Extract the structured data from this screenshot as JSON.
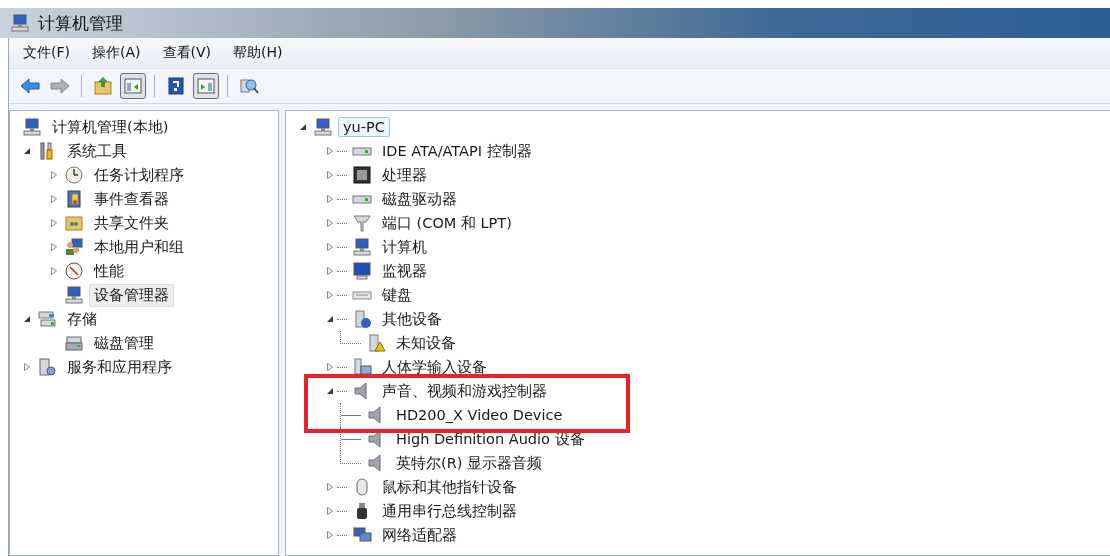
{
  "window": {
    "title": "计算机管理"
  },
  "menu": [
    {
      "label": "文件(F)"
    },
    {
      "label": "操作(A)"
    },
    {
      "label": "查看(V)"
    },
    {
      "label": "帮助(H)"
    }
  ],
  "toolbar": [
    {
      "kind": "button",
      "disabled": false,
      "pressed": false
    },
    {
      "kind": "button",
      "disabled": true,
      "pressed": false
    },
    {
      "kind": "separator"
    },
    {
      "kind": "button",
      "disabled": false,
      "pressed": false
    },
    {
      "kind": "button",
      "disabled": false,
      "pressed": true
    },
    {
      "kind": "separator"
    },
    {
      "kind": "button",
      "disabled": false,
      "pressed": false
    },
    {
      "kind": "button",
      "disabled": false,
      "pressed": true
    },
    {
      "kind": "separator"
    },
    {
      "kind": "button",
      "disabled": false,
      "pressed": false
    }
  ],
  "console_tree": {
    "items": [
      {
        "label": "计算机管理(本地)",
        "selected": false,
        "children": [
          {
            "label": "系统工具",
            "selected": false,
            "expanded": true,
            "children": [
              {
                "label": "任务计划程序",
                "selected": false,
                "expanded": false
              },
              {
                "label": "事件查看器",
                "selected": false,
                "expanded": false
              },
              {
                "label": "共享文件夹",
                "selected": false,
                "expanded": false
              },
              {
                "label": "本地用户和组",
                "selected": false,
                "expanded": false
              },
              {
                "label": "性能",
                "selected": false,
                "expanded": false
              },
              {
                "label": "设备管理器",
                "selected": true
              }
            ]
          },
          {
            "label": "存储",
            "selected": false,
            "expanded": true,
            "children": [
              {
                "label": "磁盘管理",
                "selected": false
              }
            ]
          },
          {
            "label": "服务和应用程序",
            "selected": false,
            "expanded": false
          }
        ]
      }
    ]
  },
  "device_tree": {
    "items": [
      {
        "label": "yu-PC",
        "selected": true,
        "expanded": true,
        "children": [
          {
            "label": "IDE ATA/ATAPI 控制器",
            "selected": false,
            "expanded": false
          },
          {
            "label": "处理器",
            "selected": false,
            "expanded": false
          },
          {
            "label": "磁盘驱动器",
            "selected": false,
            "expanded": false
          },
          {
            "label": "端口 (COM 和 LPT)",
            "selected": false,
            "expanded": false
          },
          {
            "label": "计算机",
            "selected": false,
            "expanded": false
          },
          {
            "label": "监视器",
            "selected": false,
            "expanded": false
          },
          {
            "label": "键盘",
            "selected": false,
            "expanded": false
          },
          {
            "label": "其他设备",
            "selected": false,
            "expanded": true,
            "children": [
              {
                "label": "未知设备",
                "selected": false
              }
            ]
          },
          {
            "label": "人体学输入设备",
            "selected": false,
            "expanded": false
          },
          {
            "label": "声音、视频和游戏控制器",
            "selected": false,
            "expanded": true,
            "highlighted": true,
            "children": [
              {
                "label": "HD200_X Video Device",
                "selected": false,
                "highlighted": true
              },
              {
                "label": "High Definition Audio 设备",
                "selected": false
              },
              {
                "label": "英特尔(R) 显示器音频",
                "selected": false
              }
            ]
          },
          {
            "label": "鼠标和其他指针设备",
            "selected": false,
            "expanded": false
          },
          {
            "label": "通用串行总线控制器",
            "selected": false,
            "expanded": false
          },
          {
            "label": "网络适配器",
            "selected": false,
            "expanded": false
          }
        ]
      }
    ]
  }
}
